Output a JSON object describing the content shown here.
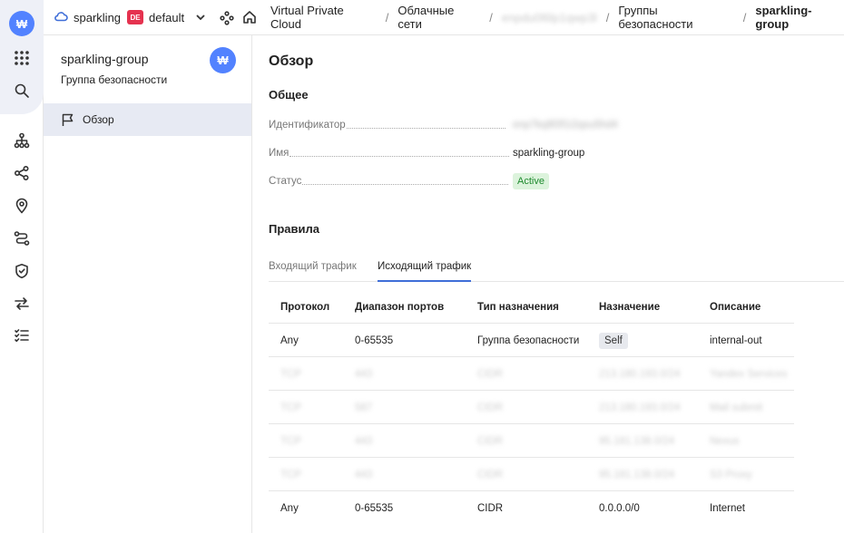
{
  "rail": {
    "logo_text": "₩",
    "icons": [
      "apps-grid-icon",
      "search-icon",
      "network-topology-icon",
      "share-nodes-icon",
      "location-pin-icon",
      "route-icon",
      "shield-icon",
      "transfer-arrows-icon",
      "checklist-icon"
    ]
  },
  "topbar": {
    "cloud_name": "sparkling",
    "region_badge": "DE",
    "folder_name": "default",
    "breadcrumbs": [
      {
        "label": "Virtual Private Cloud"
      },
      {
        "label": "Облачные сети"
      },
      {
        "label": "enpdu0l6lp1qwp3l"
      },
      {
        "label": "Группы безопасности"
      },
      {
        "label": "sparkling-group"
      }
    ]
  },
  "sidebar": {
    "title": "sparkling-group",
    "subtitle": "Группа безопасности",
    "avatar_text": "₩",
    "items": [
      {
        "label": "Обзор"
      }
    ]
  },
  "main": {
    "title": "Обзор",
    "general_heading": "Общее",
    "fields": {
      "id_label": "Идентификатор",
      "id_value": "enp7kq9l3f1i2qsu5hd4",
      "name_label": "Имя",
      "name_value": "sparkling-group",
      "status_label": "Статус",
      "status_value": "Active"
    },
    "rules_heading": "Правила",
    "tabs": [
      {
        "label": "Входящий трафик"
      },
      {
        "label": "Исходящий трафик"
      }
    ],
    "table": {
      "headers": [
        "Протокол",
        "Диапазон портов",
        "Тип назначения",
        "Назначение",
        "Описание"
      ],
      "rows": [
        [
          "Any",
          "0-65535",
          "Группа безопасности",
          "Self",
          "internal-out"
        ],
        [
          "TCP",
          "443",
          "CIDR",
          "213.180.193.0/24",
          "Yandex Services"
        ],
        [
          "TCP",
          "587",
          "CIDR",
          "213.180.193.0/24",
          "Mail submit"
        ],
        [
          "TCP",
          "443",
          "CIDR",
          "95.181.138.0/24",
          "Nexus"
        ],
        [
          "TCP",
          "443",
          "CIDR",
          "95.181.138.0/24",
          "S3 Proxy"
        ],
        [
          "Any",
          "0-65535",
          "CIDR",
          "0.0.0.0/0",
          "Internet"
        ]
      ]
    }
  },
  "colors": {
    "accent": "#5282ff",
    "tab_underline": "#3f6ed8",
    "status_bg": "#dcf3dc",
    "status_text": "#1e8a2e",
    "region_badge": "#e5324f"
  }
}
